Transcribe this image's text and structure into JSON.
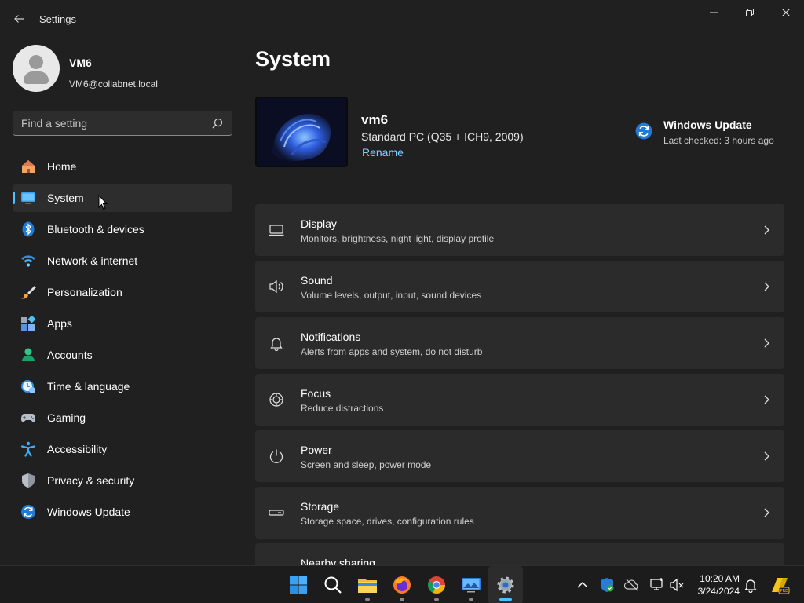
{
  "window": {
    "title": "Settings"
  },
  "profile": {
    "name": "VM6",
    "email": "VM6@collabnet.local"
  },
  "search": {
    "placeholder": "Find a setting"
  },
  "sidebar": {
    "items": [
      {
        "label": "Home",
        "icon": "home-icon"
      },
      {
        "label": "System",
        "icon": "system-icon",
        "selected": true
      },
      {
        "label": "Bluetooth & devices",
        "icon": "bluetooth-icon"
      },
      {
        "label": "Network & internet",
        "icon": "wifi-icon"
      },
      {
        "label": "Personalization",
        "icon": "brush-icon"
      },
      {
        "label": "Apps",
        "icon": "apps-icon"
      },
      {
        "label": "Accounts",
        "icon": "accounts-icon"
      },
      {
        "label": "Time & language",
        "icon": "clock-globe-icon"
      },
      {
        "label": "Gaming",
        "icon": "gamepad-icon"
      },
      {
        "label": "Accessibility",
        "icon": "accessibility-icon"
      },
      {
        "label": "Privacy & security",
        "icon": "shield-icon"
      },
      {
        "label": "Windows Update",
        "icon": "update-icon"
      }
    ]
  },
  "main": {
    "title": "System",
    "device": {
      "name": "vm6",
      "model": "Standard PC (Q35 + ICH9, 2009)",
      "rename_label": "Rename"
    },
    "windows_update": {
      "title": "Windows Update",
      "subtitle": "Last checked: 3 hours ago"
    },
    "settings": [
      {
        "title": "Display",
        "description": "Monitors, brightness, night light, display profile",
        "icon": "monitor-icon"
      },
      {
        "title": "Sound",
        "description": "Volume levels, output, input, sound devices",
        "icon": "speaker-icon"
      },
      {
        "title": "Notifications",
        "description": "Alerts from apps and system, do not disturb",
        "icon": "bell-icon"
      },
      {
        "title": "Focus",
        "description": "Reduce distractions",
        "icon": "focus-icon"
      },
      {
        "title": "Power",
        "description": "Screen and sleep, power mode",
        "icon": "power-icon"
      },
      {
        "title": "Storage",
        "description": "Storage space, drives, configuration rules",
        "icon": "storage-icon"
      },
      {
        "title": "Nearby sharing",
        "description": "",
        "icon": "share-icon"
      }
    ]
  },
  "taskbar": {
    "apps": [
      "start-icon",
      "search-icon",
      "file-explorer-icon",
      "firefox-icon",
      "chrome-icon",
      "remote-desktop-icon",
      "settings-icon"
    ],
    "time": "10:20 AM",
    "date": "3/24/2024"
  },
  "colors": {
    "accent": "#4cc2ff",
    "link": "#7fd0ff",
    "background": "#202020",
    "card": "#2b2b2b"
  }
}
